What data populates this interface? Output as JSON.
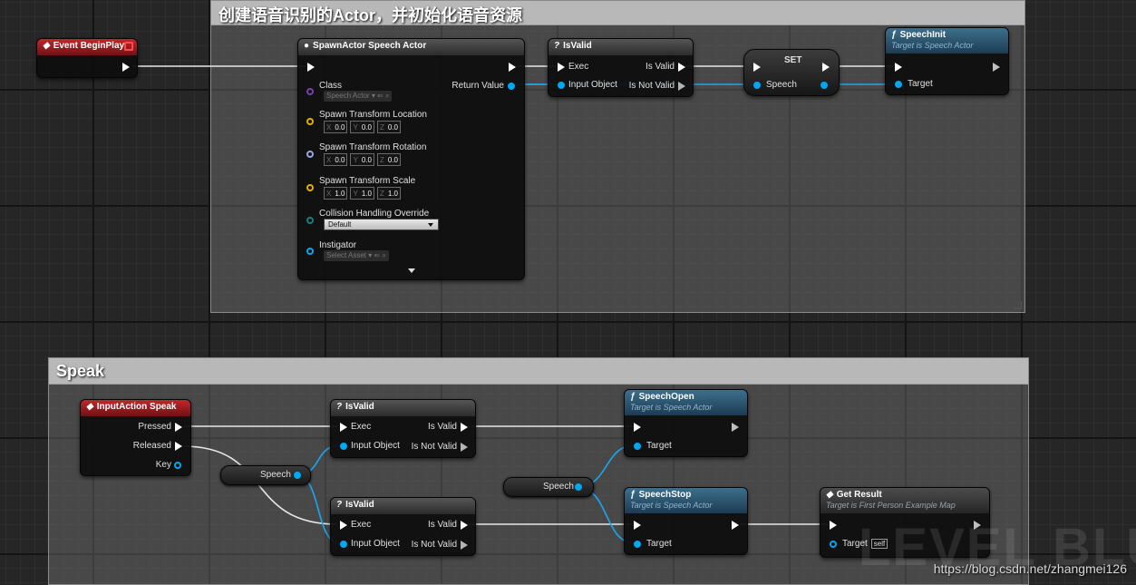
{
  "comments": {
    "top_title": "创建语音识别的Actor，并初始化语音资源",
    "bottom_title": "Speak"
  },
  "event_beginplay": {
    "title": "Event BeginPlay"
  },
  "spawn_actor": {
    "title": "SpawnActor Speech Actor",
    "class_label": "Class",
    "class_value": "Speech Actor",
    "return_value": "Return Value",
    "location_label": "Spawn Transform Location",
    "location": [
      "0.0",
      "0.0",
      "0.0"
    ],
    "rotation_label": "Spawn Transform Rotation",
    "rotation": [
      "0.0",
      "0.0",
      "0.0"
    ],
    "scale_label": "Spawn Transform Scale",
    "scale": [
      "1.0",
      "1.0",
      "1.0"
    ],
    "collision_label": "Collision Handling Override",
    "collision_value": "Default",
    "instigator_label": "Instigator",
    "instigator_value": "Select Asset",
    "axis": [
      "X",
      "Y",
      "Z"
    ]
  },
  "isvalid": {
    "title": "IsValid",
    "exec": "Exec",
    "input_object": "Input Object",
    "is_valid": "Is Valid",
    "is_not_valid": "Is Not Valid"
  },
  "set_node": {
    "title": "SET",
    "var": "Speech"
  },
  "speech_init": {
    "title": "SpeechInit",
    "subtitle": "Target is Speech Actor",
    "target": "Target"
  },
  "input_action": {
    "title": "InputAction Speak",
    "pressed": "Pressed",
    "released": "Released",
    "key": "Key"
  },
  "speech_var": "Speech",
  "speech_open": {
    "title": "SpeechOpen",
    "subtitle": "Target is Speech Actor",
    "target": "Target"
  },
  "speech_stop": {
    "title": "SpeechStop",
    "subtitle": "Target is Speech Actor",
    "target": "Target"
  },
  "get_result": {
    "title": "Get Result",
    "subtitle": "Target is First Person Example Map",
    "target": "Target",
    "self": "self"
  },
  "watermark": "LEVEL BLUE",
  "url": "https://blog.csdn.net/zhangmei126",
  "colors": {
    "exec": "#ffffff",
    "object_pin": "#00a8f3",
    "event_header": "#b11f22",
    "func_header": "#2f5a75"
  }
}
